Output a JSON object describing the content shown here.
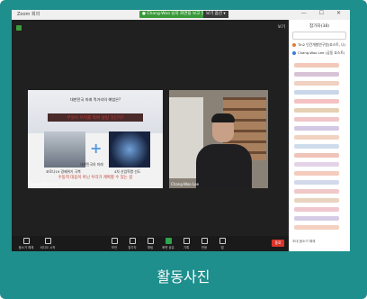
{
  "window": {
    "app_title": "Zoom 회의",
    "meeting_badge": "● Chang-Woo 님의 화면을 보고 있습니다",
    "view_options": "보기 옵션 ▾",
    "controls": "— ☐ ✕"
  },
  "stage": {
    "view_button": "보기"
  },
  "slide": {
    "question1": "대한민국 미래 먹거리의 해법은?",
    "question2": "무엇이 우리를 먹여 살릴 것인가?",
    "left_caption": "코로나19 경제위기 극복",
    "right_caption": "4차 산업혁명 선도",
    "center_caption": "대한민국의 미래",
    "bottom_line": "수동적 대응이 아닌 우리가 계획할 수 있는 길",
    "presenter_name": "Chang-Woo Lee"
  },
  "camera": {
    "participant_name": "Chang-Woo Lee"
  },
  "toolbar": {
    "items": [
      {
        "label": "음소거 해제"
      },
      {
        "label": "비디오 시작"
      },
      {
        "label": "보안"
      },
      {
        "label": "참가자"
      },
      {
        "label": "채팅"
      },
      {
        "label": "화면 공유"
      },
      {
        "label": "기록"
      },
      {
        "label": "반응"
      },
      {
        "label": "앱"
      }
    ],
    "end_label": "종료"
  },
  "panel": {
    "title": "참가자(38)",
    "rows": [
      {
        "text": "Tin2 인간개발연구원(호스트, 나)"
      },
      {
        "text": "Chang-Woo Lee (공동 호스트)"
      }
    ],
    "footer": "초대  음소거 해제"
  },
  "caption": "활동사진"
}
